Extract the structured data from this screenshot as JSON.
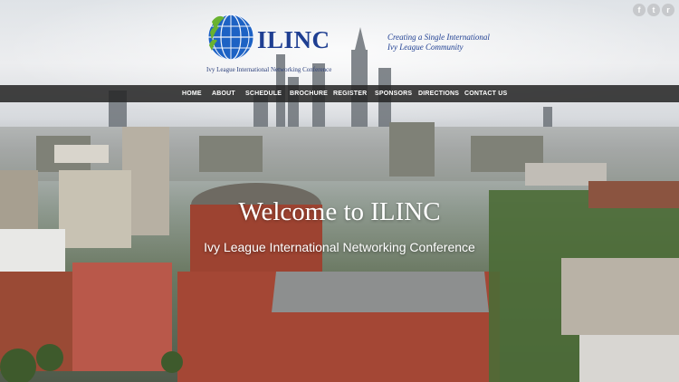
{
  "brand": {
    "name": "ILINC",
    "subtitle": "Ivy League International Networking Conference",
    "tagline_line1": "Creating a Single International",
    "tagline_line2": "Ivy League Community"
  },
  "social": {
    "facebook": "f",
    "twitter": "t",
    "rss": "r"
  },
  "nav": [
    "HOME",
    "ABOUT",
    "SCHEDULE",
    "BROCHURE",
    "REGISTER",
    "SPONSORS",
    "DIRECTIONS",
    "CONTACT US"
  ],
  "hero": {
    "title": "Welcome to ILINC",
    "subtitle": "Ivy League International Networking Conference"
  },
  "background": {
    "description_icon": "city-skyline-photo"
  }
}
